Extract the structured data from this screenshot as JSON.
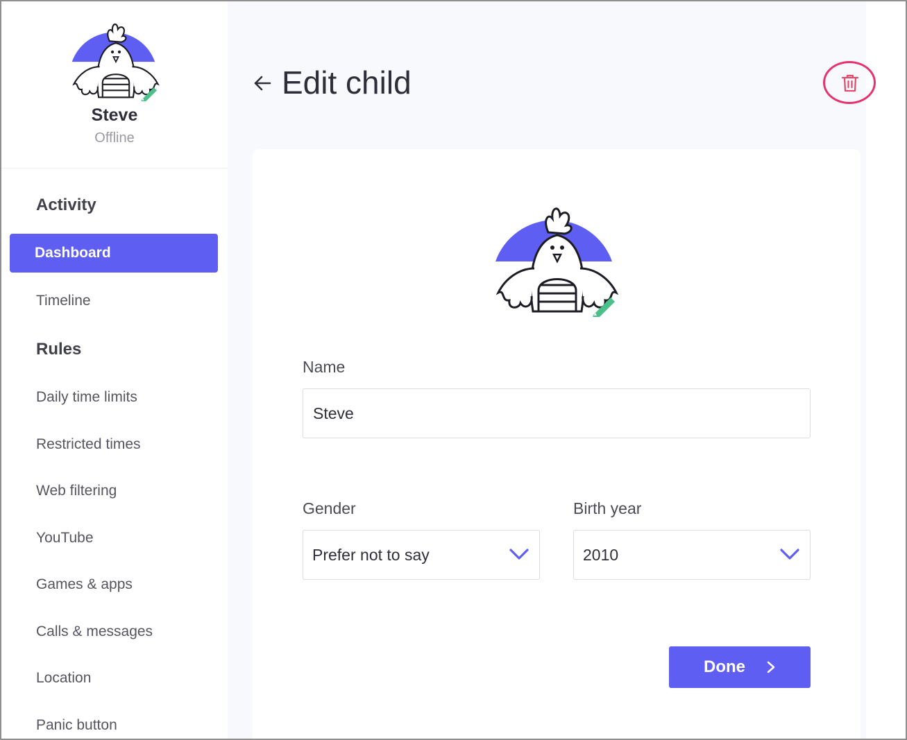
{
  "profile": {
    "name": "Steve",
    "status": "Offline"
  },
  "sidebar": {
    "activity_title": "Activity",
    "activity_items": [
      {
        "label": "Dashboard",
        "active": true
      },
      {
        "label": "Timeline",
        "active": false
      }
    ],
    "rules_title": "Rules",
    "rules_items": [
      {
        "label": "Daily time limits"
      },
      {
        "label": "Restricted times"
      },
      {
        "label": "Web filtering"
      },
      {
        "label": "YouTube"
      },
      {
        "label": "Games & apps"
      },
      {
        "label": "Calls & messages"
      },
      {
        "label": "Location"
      },
      {
        "label": "Panic button"
      }
    ]
  },
  "header": {
    "title": "Edit child",
    "back_icon": "arrow-left-icon",
    "delete_icon": "trash-icon"
  },
  "form": {
    "name_label": "Name",
    "name_value": "Steve",
    "gender_label": "Gender",
    "gender_value": "Prefer not to say",
    "birth_year_label": "Birth year",
    "birth_year_value": "2010",
    "done_label": "Done"
  },
  "colors": {
    "accent": "#5f5ef3",
    "delete_highlight": "#e6336e",
    "edit_pencil": "#4cbf8a"
  }
}
